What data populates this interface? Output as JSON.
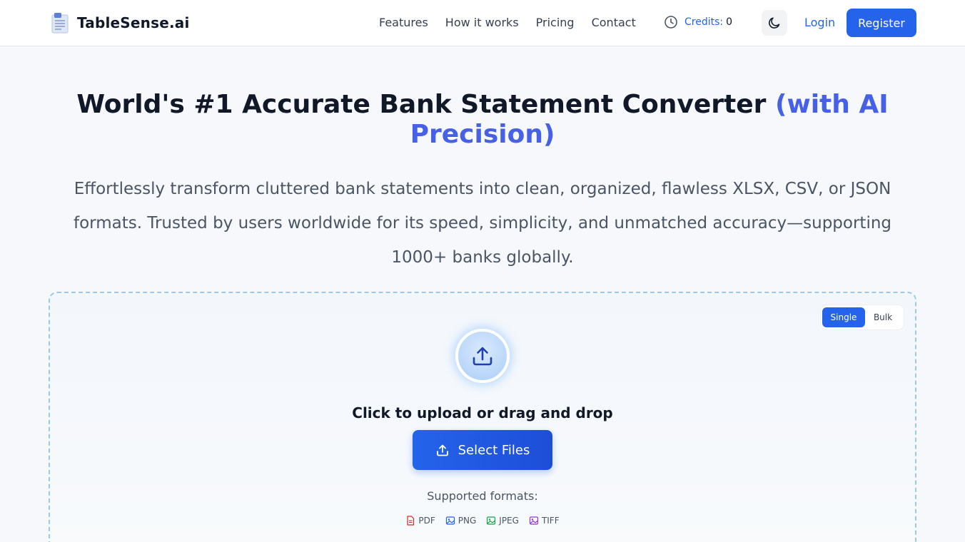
{
  "header": {
    "brand": "TableSense.ai",
    "nav": [
      "Features",
      "How it works",
      "Pricing",
      "Contact"
    ],
    "credits_label": "Credits",
    "credits_sep": ":",
    "credits_value": "0",
    "login": "Login",
    "register": "Register"
  },
  "hero": {
    "title_main": "World's #1 Accurate Bank Statement Converter",
    "title_accent": "(with AI Precision)",
    "subtitle": "Effortlessly transform cluttered bank statements into clean, organized, flawless XLSX, CSV, or JSON formats. Trusted by users worldwide for its speed, simplicity, and unmatched accuracy—supporting 1000+ banks globally."
  },
  "upload": {
    "mode_single": "Single",
    "mode_bulk": "Bulk",
    "heading": "Click to upload or drag and drop",
    "button": "Select Files",
    "formats_label": "Supported formats:",
    "formats": [
      {
        "label": "PDF",
        "icon": "pdf-file-icon",
        "color": "#dc2626"
      },
      {
        "label": "PNG",
        "icon": "image-icon",
        "color": "#2563eb"
      },
      {
        "label": "JPEG",
        "icon": "image-icon",
        "color": "#16a34a"
      },
      {
        "label": "TIFF",
        "icon": "image-icon",
        "color": "#9333ea"
      }
    ]
  },
  "colors": {
    "primary": "#2563eb",
    "accent": "#4661e6",
    "dashed_border": "#9cc9ea"
  }
}
